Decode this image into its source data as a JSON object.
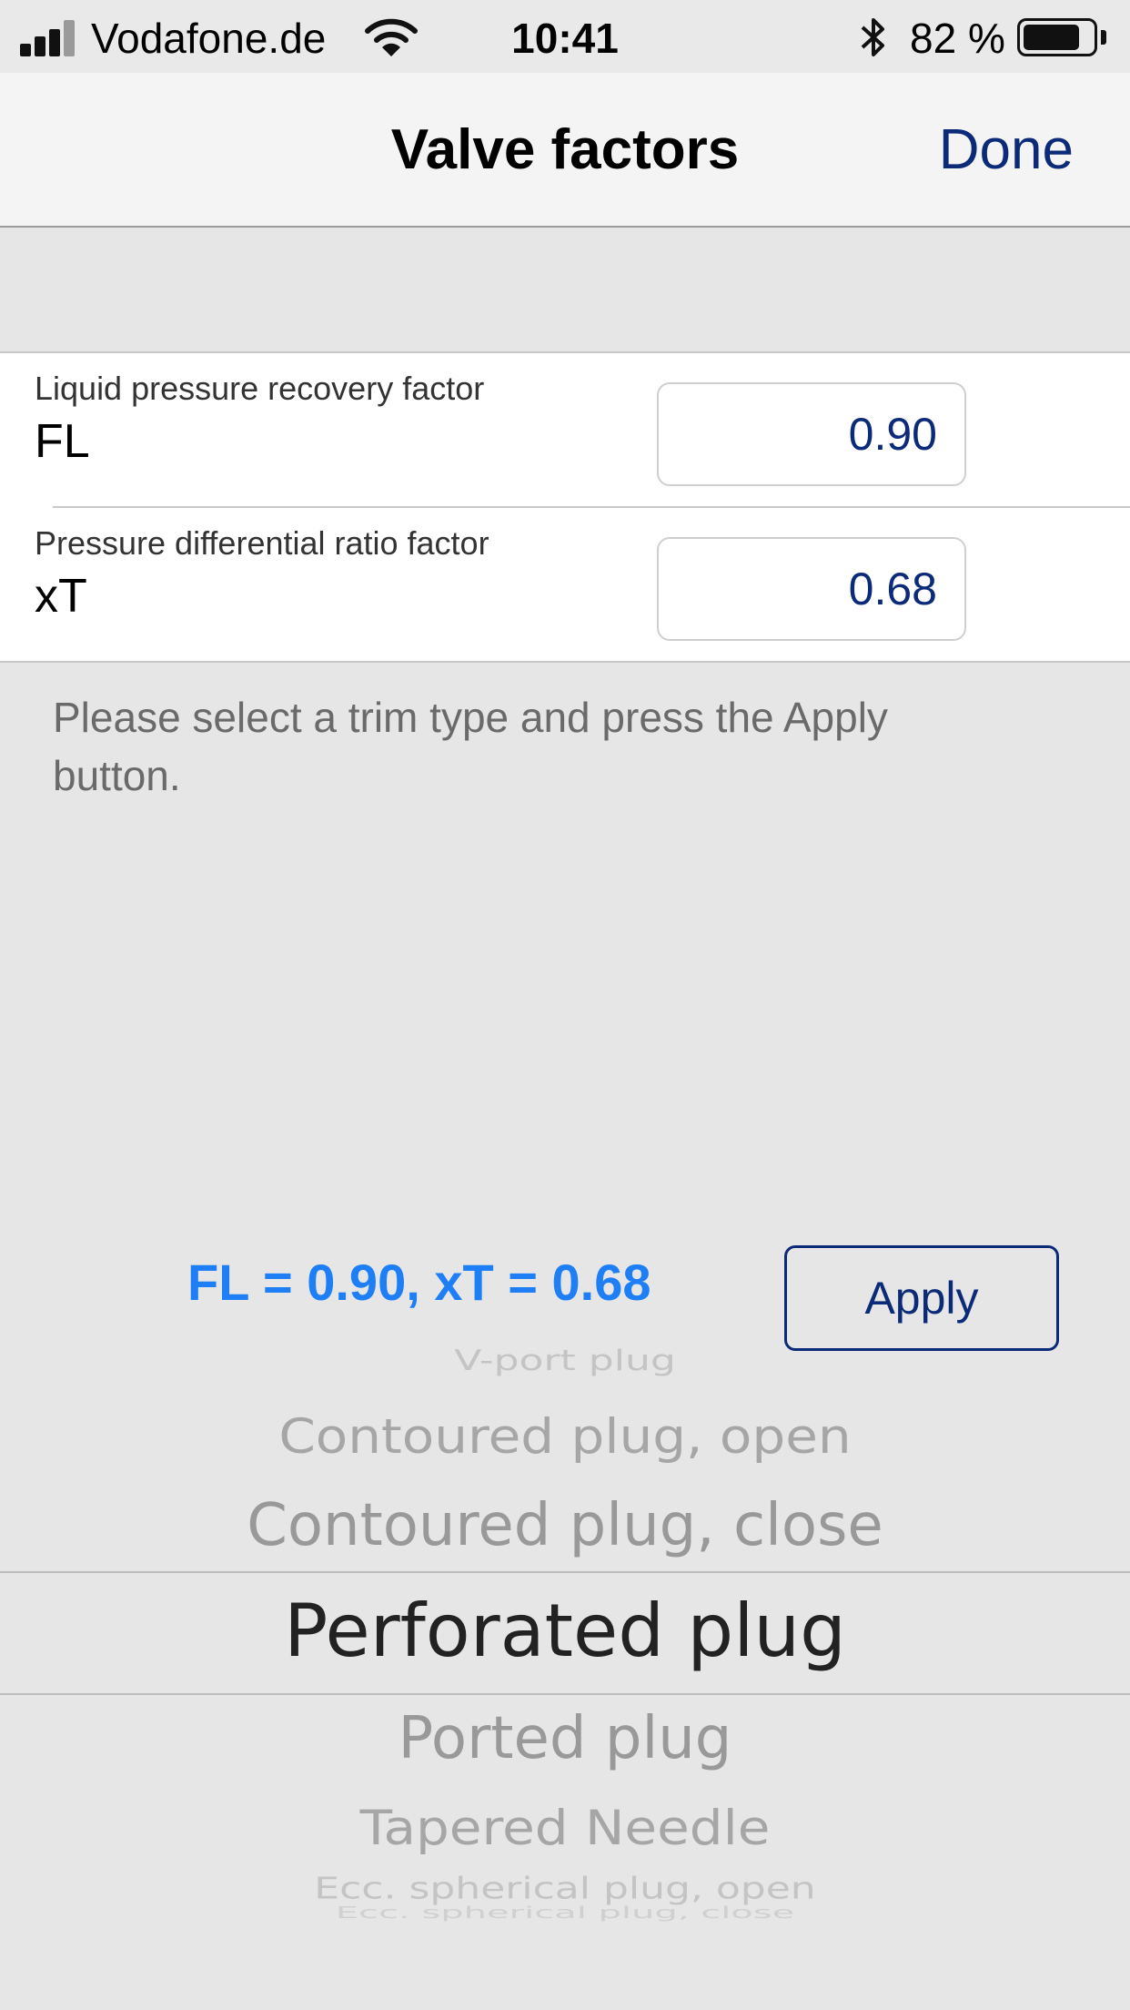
{
  "status_bar": {
    "carrier": "Vodafone.de",
    "time": "10:41",
    "battery_percent": "82 %",
    "battery_level": 0.82
  },
  "nav": {
    "title": "Valve factors",
    "done_label": "Done"
  },
  "factors": [
    {
      "description": "Liquid pressure recovery factor",
      "symbol": "FL",
      "value": "0.90"
    },
    {
      "description": "Pressure differential ratio factor",
      "symbol": "xT",
      "value": "0.68"
    }
  ],
  "instructions": "Please select a trim type and press the Apply button.",
  "result": "FL = 0.90, xT =  0.68",
  "apply_label": "Apply",
  "picker": {
    "items": [
      "V-port plug",
      "Contoured plug, open",
      "Contoured plug, close",
      "Perforated plug",
      "Ported plug",
      "Tapered Needle",
      "Ecc. spherical plug, open",
      "Ecc. spherical plug, close"
    ],
    "selected": "Perforated plug"
  },
  "colors": {
    "accent": "#0b2a78",
    "result": "#1d7ef5",
    "background": "#e6e6e6"
  }
}
